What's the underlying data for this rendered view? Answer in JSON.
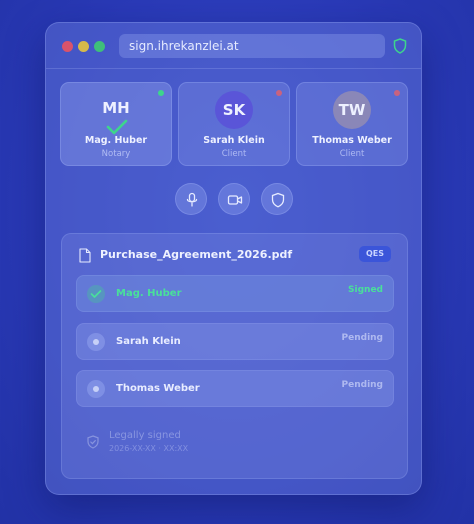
{
  "browser": {
    "url": "sign.ihrekanzlei.at"
  },
  "participants": [
    {
      "initials": "MH",
      "name": "Mag. Huber",
      "role": "Notary",
      "status": "online"
    },
    {
      "initials": "SK",
      "name": "Sarah Klein",
      "role": "Client",
      "status": "offline"
    },
    {
      "initials": "TW",
      "name": "Thomas Weber",
      "role": "Client",
      "status": "offline"
    }
  ],
  "controls": {
    "icons": [
      "microphone-icon",
      "video-camera-icon",
      "shield-icon"
    ]
  },
  "document": {
    "filename": "Purchase_Agreement_2026.pdf",
    "badge": "QES",
    "signers": [
      {
        "name": "Mag. Huber",
        "status": "Signed"
      },
      {
        "name": "Sarah Klein",
        "status": "Pending"
      },
      {
        "name": "Thomas Weber",
        "status": "Pending"
      }
    ],
    "legal": {
      "title": "Legally signed",
      "timestamp": "2026-XX-XX · XX:XX"
    }
  },
  "colors": {
    "accent_green": "#3dd68c",
    "badge_blue": "#3b55d9",
    "background": "#2a3ab8"
  }
}
